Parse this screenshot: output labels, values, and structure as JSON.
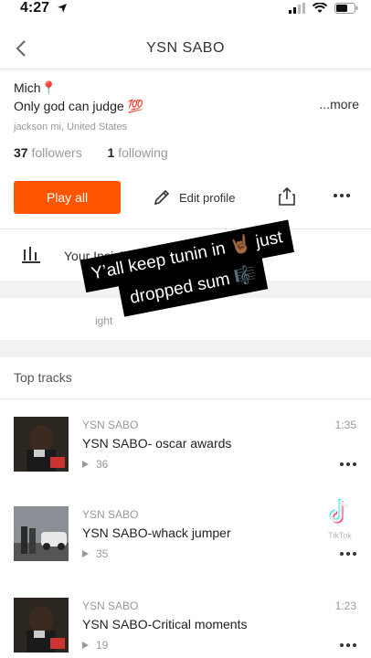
{
  "status_bar": {
    "time": "4:27"
  },
  "nav": {
    "title": "YSN SABO"
  },
  "profile": {
    "bio_line1": "Mich📍",
    "bio_line2": "Only god can judge 💯",
    "more_label": "...more",
    "location": "jackson mi, United States",
    "followers_count": "37",
    "followers_label": "followers",
    "following_count": "1",
    "following_label": "following"
  },
  "actions": {
    "play_all_label": "Play all",
    "edit_profile_label": "Edit profile"
  },
  "insights": {
    "label": "Your Insights"
  },
  "spotlight": {
    "label": "ight"
  },
  "top_tracks": {
    "title": "Top tracks",
    "items": [
      {
        "artist": "YSN SABO",
        "title": "YSN SABO- oscar awards",
        "plays": "36",
        "duration": "1:35"
      },
      {
        "artist": "YSN SABO",
        "title": "YSN SABO-whack jumper",
        "plays": "35",
        "duration": ""
      },
      {
        "artist": "YSN SABO",
        "title": "YSN SABO-Critical moments",
        "plays": "19",
        "duration": "1:23"
      }
    ]
  },
  "overlay": {
    "line1": "Y’all keep tunin in 🤘🏾 just",
    "line2": "dropped sum 🎼"
  },
  "watermark": {
    "label": "TikTok"
  },
  "colors": {
    "accent": "#ff5500",
    "muted": "#999999",
    "background": "#ffffff"
  }
}
